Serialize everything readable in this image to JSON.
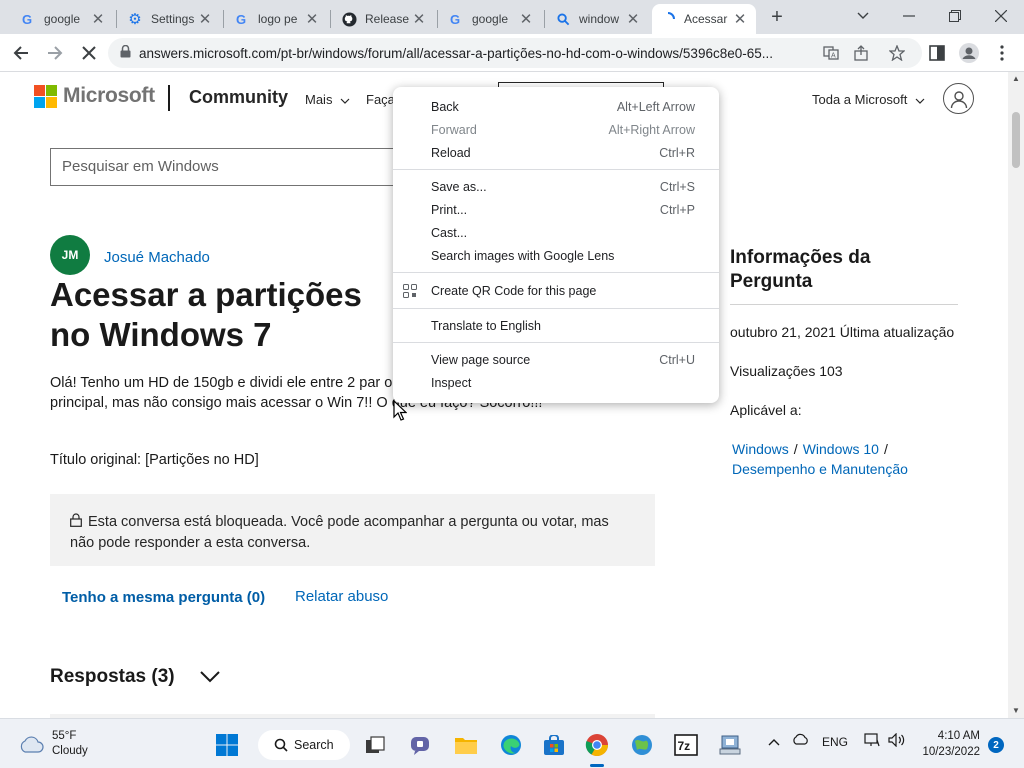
{
  "browser": {
    "tabs": [
      {
        "title": "google",
        "icon": "google-icon",
        "active": false
      },
      {
        "title": "Settings",
        "icon": "settings-gear-icon",
        "active": false
      },
      {
        "title": "logo pe",
        "icon": "google-icon",
        "active": false
      },
      {
        "title": "Release",
        "icon": "github-icon",
        "active": false
      },
      {
        "title": "google",
        "icon": "google-icon",
        "active": false
      },
      {
        "title": "window",
        "icon": "search-icon",
        "active": false
      },
      {
        "title": "Acessar",
        "icon": "loading-spinner-icon",
        "active": true
      }
    ],
    "url": "answers.microsoft.com/pt-br/windows/forum/all/acessar-a-partições-no-hd-com-o-windows/5396c8e0-65..."
  },
  "header": {
    "brand": "Microsoft",
    "section": "Community",
    "nav": [
      "Mais",
      "Faça"
    ],
    "all_microsoft": "Toda a Microsoft"
  },
  "search": {
    "placeholder": "Pesquisar em Windows"
  },
  "question": {
    "avatar_initials": "JM",
    "author": "Josué Machado",
    "title": "Acessar a partições no Windows 7",
    "body": "Olá! Tenho um HD de 150gb e dividi ele entre 2 par o Win 10. O Windows 10 como sistema principal, mas não consigo mais acessar o Win 7!! O que eu faço? Socorro!!!",
    "original_title": "Título original: [Partições no HD]",
    "locked_notice": "Esta conversa está bloqueada. Você pode acompanhar a pergunta ou votar, mas não pode responder a esta conversa.",
    "same_question": "Tenho a mesma pergunta (0)",
    "report_abuse": "Relatar abuso",
    "answers_heading": "Respostas (3)"
  },
  "info": {
    "heading": "Informações da Pergunta",
    "updated": "outubro 21, 2021 Última atualização",
    "views": "Visualizações 103",
    "applies_to": "Aplicável a:",
    "tags": [
      "Windows",
      "Windows 10",
      "Desempenho e Manutenção"
    ]
  },
  "context_menu": {
    "items": [
      {
        "label": "Back",
        "shortcut": "Alt+Left Arrow",
        "disabled": false
      },
      {
        "label": "Forward",
        "shortcut": "Alt+Right Arrow",
        "disabled": true
      },
      {
        "label": "Reload",
        "shortcut": "Ctrl+R",
        "disabled": false
      },
      {
        "label": "Save as...",
        "shortcut": "Ctrl+S",
        "disabled": false
      },
      {
        "label": "Print...",
        "shortcut": "Ctrl+P",
        "disabled": false
      },
      {
        "label": "Cast...",
        "shortcut": "",
        "disabled": false
      },
      {
        "label": "Search images with Google Lens",
        "shortcut": "",
        "disabled": false
      },
      {
        "label": "Create QR Code for this page",
        "shortcut": "",
        "disabled": false
      },
      {
        "label": "Translate to English",
        "shortcut": "",
        "disabled": false
      },
      {
        "label": "View page source",
        "shortcut": "Ctrl+U",
        "disabled": false
      },
      {
        "label": "Inspect",
        "shortcut": "",
        "disabled": false
      }
    ]
  },
  "taskbar": {
    "weather_temp": "55°F",
    "weather_desc": "Cloudy",
    "search_label": "Search",
    "language": "ENG",
    "time": "4:10 AM",
    "date": "10/23/2022",
    "notification_count": "2"
  },
  "colors": {
    "accent": "#0067b8",
    "avatar_bg": "#107c41",
    "ms_red": "#f25022",
    "ms_green": "#7fba00",
    "ms_blue": "#00a4ef",
    "ms_yellow": "#ffb900"
  }
}
